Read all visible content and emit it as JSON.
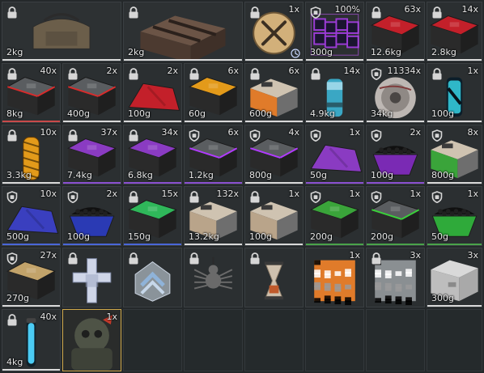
{
  "inventory": {
    "items": [
      {
        "name": "gear-bag-icon",
        "qty": "",
        "weight": "2kg",
        "badge": "lock",
        "underline": "white",
        "color": "#6b5e4a"
      },
      {
        "name": "ammo-crate-icon",
        "qty": "",
        "weight": "2kg",
        "badge": "lock",
        "underline": "white",
        "color": "#5a4a3a"
      },
      {
        "name": "crossed-tools-icon",
        "qty": "1x",
        "weight": "",
        "badge": "lock",
        "underline": "white",
        "color": "#c9a56a",
        "clock": true
      },
      {
        "name": "purple-cubes-icon",
        "qty": "100%",
        "weight": "300g",
        "badge": "shield",
        "underline": "white",
        "color": "#9b3bd6"
      },
      {
        "name": "red-case-icon",
        "qty": "63x",
        "weight": "12.6kg",
        "badge": "lock",
        "underline": "white",
        "color": "#c3202a"
      },
      {
        "name": "red-case-icon",
        "qty": "14x",
        "weight": "2.8kg",
        "badge": "lock",
        "underline": "white",
        "color": "#c3202a"
      },
      {
        "name": "gray-case-red-trim-icon",
        "qty": "40x",
        "weight": "8kg",
        "badge": "lock",
        "underline": "red",
        "color": "#5a5d60"
      },
      {
        "name": "gray-case-red-trim-icon",
        "qty": "2x",
        "weight": "400g",
        "badge": "lock",
        "underline": "white",
        "color": "#5a5d60"
      },
      {
        "name": "red-cloth-icon",
        "qty": "2x",
        "weight": "100g",
        "badge": "lock",
        "underline": "white",
        "color": "#c3202a"
      },
      {
        "name": "orange-black-case-icon",
        "qty": "6x",
        "weight": "60g",
        "badge": "lock",
        "underline": "white",
        "color": "#e39a1a"
      },
      {
        "name": "orange-toolbox-icon",
        "qty": "6x",
        "weight": "600g",
        "badge": "lock",
        "underline": "white",
        "color": "#e07b2a"
      },
      {
        "name": "teal-canister-icon",
        "qty": "14x",
        "weight": "4.9kg",
        "badge": "lock",
        "underline": "white",
        "color": "#3aa7c4"
      },
      {
        "name": "cable-spool-icon",
        "qty": "11334x",
        "weight": "34kg",
        "badge": "shield",
        "underline": "white",
        "color": "#9e9a98"
      },
      {
        "name": "cyan-can-icon",
        "qty": "1x",
        "weight": "100g",
        "badge": "lock",
        "underline": "white",
        "color": "#2fb7c8"
      },
      {
        "name": "orange-tube-icon",
        "qty": "10x",
        "weight": "3.3kg",
        "badge": "lock",
        "underline": "white",
        "color": "#e39a1a"
      },
      {
        "name": "purple-case-icon",
        "qty": "37x",
        "weight": "7.4kg",
        "badge": "lock",
        "underline": "purple",
        "color": "#8a3bc2"
      },
      {
        "name": "purple-case-icon",
        "qty": "34x",
        "weight": "6.8kg",
        "badge": "lock",
        "underline": "purple",
        "color": "#8a3bc2"
      },
      {
        "name": "gray-case-purple-trim-icon",
        "qty": "6x",
        "weight": "1.2kg",
        "badge": "shield",
        "underline": "purple",
        "color": "#5a5d60"
      },
      {
        "name": "gray-case-purple-trim-icon",
        "qty": "4x",
        "weight": "800g",
        "badge": "shield",
        "underline": "white",
        "color": "#5a5d60"
      },
      {
        "name": "purple-cloth-icon",
        "qty": "1x",
        "weight": "50g",
        "badge": "shield",
        "underline": "purple",
        "color": "#8a3bc2"
      },
      {
        "name": "purple-bin-icon",
        "qty": "2x",
        "weight": "100g",
        "badge": "shield",
        "underline": "purple",
        "color": "#7a2ab4"
      },
      {
        "name": "green-toolbox-icon",
        "qty": "8x",
        "weight": "800g",
        "badge": "shield",
        "underline": "white",
        "color": "#3aa43a"
      },
      {
        "name": "blue-cloth-icon",
        "qty": "10x",
        "weight": "500g",
        "badge": "shield",
        "underline": "blue",
        "color": "#3a3fbf"
      },
      {
        "name": "blue-bin-icon",
        "qty": "2x",
        "weight": "100g",
        "badge": "shield",
        "underline": "blue",
        "color": "#2a3ab4"
      },
      {
        "name": "green-black-case-icon",
        "qty": "15x",
        "weight": "150g",
        "badge": "lock",
        "underline": "blue",
        "color": "#2fb75a"
      },
      {
        "name": "tan-toolbox-icon",
        "qty": "132x",
        "weight": "13.2kg",
        "badge": "lock",
        "underline": "white",
        "color": "#b9a48a"
      },
      {
        "name": "tan-toolbox-icon",
        "qty": "1x",
        "weight": "100g",
        "badge": "lock",
        "underline": "white",
        "color": "#b9a48a"
      },
      {
        "name": "green-case-icon",
        "qty": "1x",
        "weight": "200g",
        "badge": "shield",
        "underline": "green",
        "color": "#3aa43a"
      },
      {
        "name": "gray-case-green-trim-icon",
        "qty": "1x",
        "weight": "200g",
        "badge": "shield",
        "underline": "green",
        "color": "#5a5d60"
      },
      {
        "name": "green-bin-icon",
        "qty": "1x",
        "weight": "50g",
        "badge": "shield",
        "underline": "green",
        "color": "#2faa3a"
      },
      {
        "name": "black-tan-case-icon",
        "qty": "27x",
        "weight": "270g",
        "badge": "shield",
        "underline": "white",
        "color": "#c2a36a"
      },
      {
        "name": "cross-tag-icon",
        "qty": "",
        "weight": "",
        "badge": "lock",
        "underline": "",
        "color": "#cfd6e8"
      },
      {
        "name": "chevron-badge-icon",
        "qty": "",
        "weight": "",
        "badge": "lock",
        "underline": "",
        "color": "#8fb3d9"
      },
      {
        "name": "spider-icon",
        "qty": "",
        "weight": "",
        "badge": "lock",
        "underline": "",
        "color": "#6a6a6a"
      },
      {
        "name": "hourglass-pendant-icon",
        "qty": "",
        "weight": "",
        "badge": "lock",
        "underline": "",
        "color": "#d9c9b2"
      },
      {
        "name": "orange-camo-icon",
        "qty": "1x",
        "weight": "",
        "badge": "",
        "underline": "",
        "color": "#e07b2a"
      },
      {
        "name": "gray-camo-icon",
        "qty": "3x",
        "weight": "",
        "badge": "lock",
        "underline": "",
        "color": "#8a8f92"
      },
      {
        "name": "silver-case-icon",
        "qty": "3x",
        "weight": "300g",
        "badge": "",
        "underline": "white",
        "color": "#c8c8c8"
      },
      {
        "name": "glowstick-icon",
        "qty": "40x",
        "weight": "4kg",
        "badge": "lock",
        "underline": "white",
        "color": "#4fd6ff"
      },
      {
        "name": "soldier-portrait-icon",
        "qty": "1x",
        "weight": "",
        "badge": "",
        "underline": "",
        "color": "#7a7a5a"
      }
    ]
  }
}
